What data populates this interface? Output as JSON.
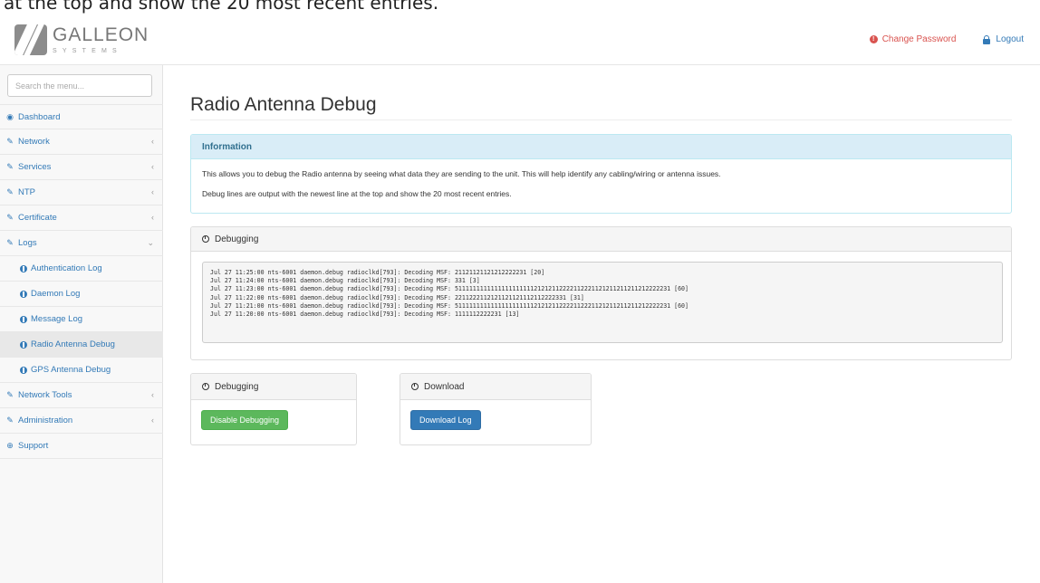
{
  "caption_fragment": "at the top and show the 20 most recent entries.",
  "header": {
    "logo_title": "GALLEON",
    "logo_sub": "SYSTEMS",
    "change_password": "Change Password",
    "logout": "Logout"
  },
  "sidebar": {
    "search_placeholder": "Search the menu...",
    "items": [
      {
        "label": "Dashboard",
        "icon": "dashboard-icon"
      },
      {
        "label": "Network",
        "icon": "wrench-icon"
      },
      {
        "label": "Services",
        "icon": "wrench-icon"
      },
      {
        "label": "NTP",
        "icon": "wrench-icon"
      },
      {
        "label": "Certificate",
        "icon": "wrench-icon"
      },
      {
        "label": "Logs",
        "icon": "wrench-icon"
      },
      {
        "label": "Authentication Log",
        "icon": "info-circle-icon"
      },
      {
        "label": "Daemon Log",
        "icon": "info-circle-icon"
      },
      {
        "label": "Message Log",
        "icon": "info-circle-icon"
      },
      {
        "label": "Radio Antenna Debug",
        "icon": "info-circle-icon"
      },
      {
        "label": "GPS Antenna Debug",
        "icon": "info-circle-icon"
      },
      {
        "label": "Network Tools",
        "icon": "wrench-icon"
      },
      {
        "label": "Administration",
        "icon": "wrench-icon"
      },
      {
        "label": "Support",
        "icon": "lifebuoy-icon"
      }
    ]
  },
  "main": {
    "title": "Radio Antenna Debug",
    "info": {
      "heading": "Information",
      "line1": "This allows you to debug the Radio antenna by seeing what data they are sending to the unit. This will help identify any cabling/wiring or antenna issues.",
      "line2": "Debug lines are output with the newest line at the top and show the 20 most recent entries."
    },
    "debug_panel": {
      "heading": "Debugging",
      "log_lines": [
        "Jul 27 11:25:00 nts-6001 daemon.debug radioclkd[793]: Decoding MSF: 21121121121212222231 [20]",
        "Jul 27 11:24:00 nts-6001 daemon.debug radioclkd[793]: Decoding MSF: 331 [3]",
        "Jul 27 11:23:00 nts-6001 daemon.debug radioclkd[793]: Decoding MSF: 511111111111111111111121212112222112221121211211211212222231 [60]",
        "Jul 27 11:22:00 nts-6001 daemon.debug radioclkd[793]: Decoding MSF: 2211222112121121121112112222331 [31]",
        "Jul 27 11:21:00 nts-6001 daemon.debug radioclkd[793]: Decoding MSF: 511111111111111111111121212112222112221121211211211212222231 [60]",
        "Jul 27 11:20:00 nts-6001 daemon.debug radioclkd[793]: Decoding MSF: 1111112222231 [13]"
      ]
    },
    "toggle_panel": {
      "heading": "Debugging",
      "button": "Disable Debugging"
    },
    "download_panel": {
      "heading": "Download",
      "button": "Download Log"
    }
  },
  "colors": {
    "link": "#337ab7",
    "danger": "#d9534f",
    "success": "#5cb85c",
    "info_bg": "#d9edf7"
  }
}
